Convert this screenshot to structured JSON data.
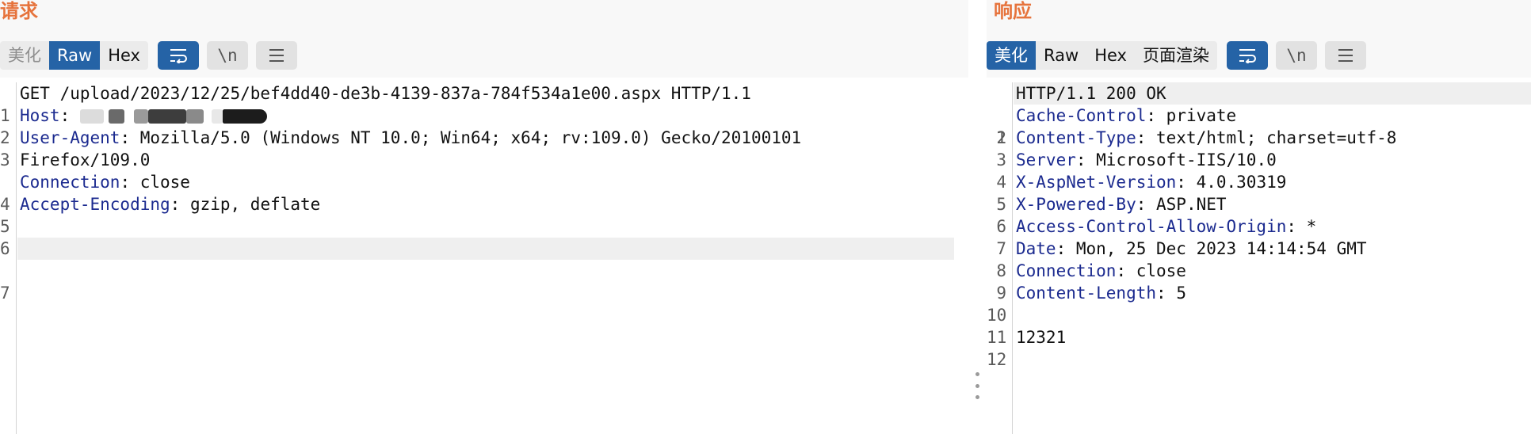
{
  "request": {
    "title": "请求",
    "tabs": [
      {
        "label": "美化",
        "state": "disabled"
      },
      {
        "label": "Raw",
        "state": "active"
      },
      {
        "label": "Hex",
        "state": "normal"
      }
    ],
    "tool_icons": {
      "wrap": "↩︎",
      "newline": "\\n",
      "menu": "☰"
    },
    "line_numbers": [
      "1",
      "2",
      "3",
      "",
      "4",
      "5",
      "6",
      "7"
    ],
    "lines": {
      "l1_text": "GET /upload/2023/12/25/bef4dd40-de3b-4139-837a-784f534a1e00.aspx HTTP/1.1",
      "host_name": "Host",
      "host_sep": ": ",
      "ua_name": "User-Agent",
      "ua_sep": ": ",
      "ua_value": "Mozilla/5.0 (Windows NT 10.0; Win64; x64; rv:109.0) Gecko/20100101",
      "ua_cont": "Firefox/109.0",
      "conn_name": "Connection",
      "conn_sep": ": ",
      "conn_value": "close",
      "enc_name": "Accept-Encoding",
      "enc_sep": ": ",
      "enc_value": "gzip, deflate"
    }
  },
  "response": {
    "title": "响应",
    "tabs": [
      {
        "label": "美化",
        "state": "active"
      },
      {
        "label": "Raw",
        "state": "normal"
      },
      {
        "label": "Hex",
        "state": "normal"
      },
      {
        "label": "页面渲染",
        "state": "normal"
      }
    ],
    "tool_icons": {
      "wrap": "↩︎",
      "newline": "\\n",
      "menu": "☰"
    },
    "line_numbers": [
      "1",
      "2",
      "3",
      "4",
      "5",
      "6",
      "7",
      "8",
      "9",
      "10",
      "11",
      "12"
    ],
    "lines": {
      "status": "HTTP/1.1 200 OK",
      "headers": [
        {
          "name": "Cache-Control",
          "value": "private"
        },
        {
          "name": "Content-Type",
          "value": "text/html; charset=utf-8"
        },
        {
          "name": "Server",
          "value": "Microsoft-IIS/10.0"
        },
        {
          "name": "X-AspNet-Version",
          "value": "4.0.30319"
        },
        {
          "name": "X-Powered-By",
          "value": "ASP.NET"
        },
        {
          "name": "Access-Control-Allow-Origin",
          "value": "*"
        },
        {
          "name": "Date",
          "value": "Mon, 25 Dec 2023 14:14:54 GMT"
        },
        {
          "name": "Connection",
          "value": "close"
        },
        {
          "name": "Content-Length",
          "value": "5"
        }
      ],
      "sep": ": ",
      "body": "12321"
    }
  },
  "colors": {
    "title": "#e6733c",
    "accent": "#2563a6",
    "header_name": "#1b2a8f"
  }
}
